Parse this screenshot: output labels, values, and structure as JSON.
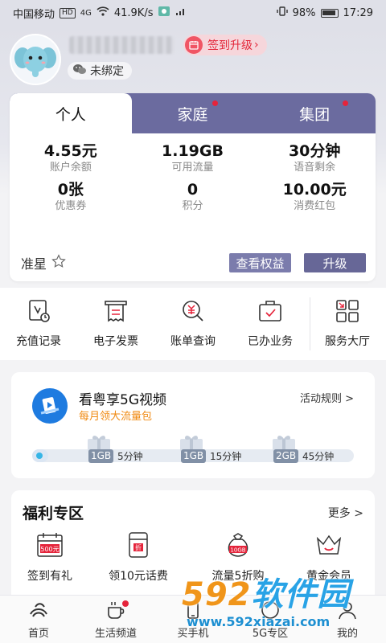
{
  "status_bar": {
    "carrier": "中国移动",
    "hd_badge": "HD",
    "network": "4G",
    "speed": "41.9K/s",
    "battery": "98%",
    "time": "17:29"
  },
  "profile": {
    "signin_label": "签到升级",
    "binding_status": "未绑定"
  },
  "tabs": [
    {
      "label": "个人",
      "active": true
    },
    {
      "label": "家庭",
      "dot": true
    },
    {
      "label": "集团",
      "dot": true
    }
  ],
  "stats": [
    {
      "value": "4.55元",
      "label": "账户余额"
    },
    {
      "value": "1.19GB",
      "label": "可用流量"
    },
    {
      "value": "30分钟",
      "label": "语音剩余"
    },
    {
      "value": "0张",
      "label": "优惠券"
    },
    {
      "value": "0",
      "label": "积分"
    },
    {
      "value": "10.00元",
      "label": "消费红包"
    }
  ],
  "account": {
    "level": "准星",
    "rights_button": "查看权益",
    "upgrade_button": "升级"
  },
  "services": [
    {
      "label": "充值记录",
      "icon": "recharge-record-icon"
    },
    {
      "label": "电子发票",
      "icon": "invoice-icon"
    },
    {
      "label": "账单查询",
      "icon": "bill-search-icon"
    },
    {
      "label": "已办业务",
      "icon": "handled-business-icon"
    },
    {
      "label": "服务大厅",
      "icon": "service-hall-icon"
    }
  ],
  "video_promo": {
    "title": "看粤享5G视频",
    "subtitle": "每月领大流量包",
    "rules_link": "活动规则 >",
    "progress": 0.05,
    "milestones": [
      {
        "tag": "1GB",
        "label": "5分钟"
      },
      {
        "tag": "1GB",
        "label": "15分钟"
      },
      {
        "tag": "2GB",
        "label": "45分钟"
      }
    ]
  },
  "welfare": {
    "title": "福利专区",
    "more": "更多 >",
    "items": [
      {
        "label": "签到有礼",
        "icon_text": "500元"
      },
      {
        "label": "领10元话费",
        "icon_text": "折"
      },
      {
        "label": "流量5折购",
        "icon_text": "10GB"
      },
      {
        "label": "黄金会员",
        "icon_text": ""
      }
    ]
  },
  "tabbar": [
    {
      "label": "首页"
    },
    {
      "label": "生活频道",
      "dot": true
    },
    {
      "label": "买手机"
    },
    {
      "label": "5G专区"
    },
    {
      "label": "我的"
    }
  ],
  "watermark": {
    "brand_num": "592",
    "brand_text": "软件园",
    "url": "www.592xiazai.com"
  },
  "colors": {
    "tab_bar_purple": "#6b6b9f",
    "accent_red": "#e3273a",
    "promo_orange": "#f08a12",
    "progress_blue": "#36b5e6"
  }
}
